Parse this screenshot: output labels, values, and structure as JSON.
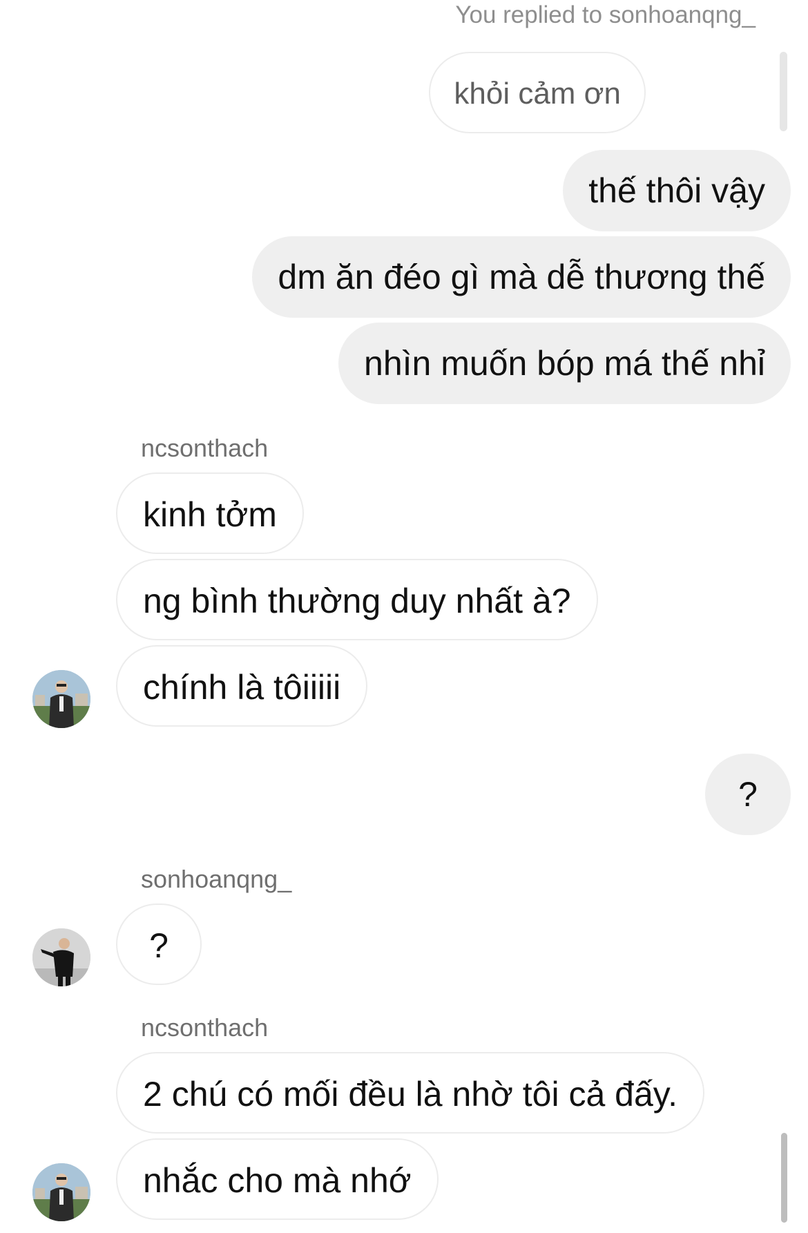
{
  "header": {
    "reply_note": "You replied to sonhoanqng_"
  },
  "quoted": {
    "text": "khỏi cảm ơn"
  },
  "messages": {
    "out_1": "thế thôi vậy",
    "out_2": "dm ăn đéo gì mà dễ thương thế",
    "out_3": "nhìn muốn bóp má thế nhỉ",
    "sender_1": "ncsonthach",
    "in_1": "kinh tởm",
    "in_2": "ng bình thường duy nhất à?",
    "in_3": "chính là tôiiiii",
    "out_4": "?",
    "sender_2": "sonhoanqng_",
    "in_4": "?",
    "sender_3": "ncsonthach",
    "in_5": "2 chú có mối đều là nhờ tôi cả đấy.",
    "in_6": "nhắc cho mà nhớ"
  },
  "colors": {
    "outgoing_bubble": "#efefef",
    "incoming_border": "#ececec",
    "secondary_text": "#8e8e8e"
  },
  "avatars": [
    {
      "user": "ncsonthach"
    },
    {
      "user": "sonhoanqng_"
    },
    {
      "user": "ncsonthach"
    }
  ]
}
